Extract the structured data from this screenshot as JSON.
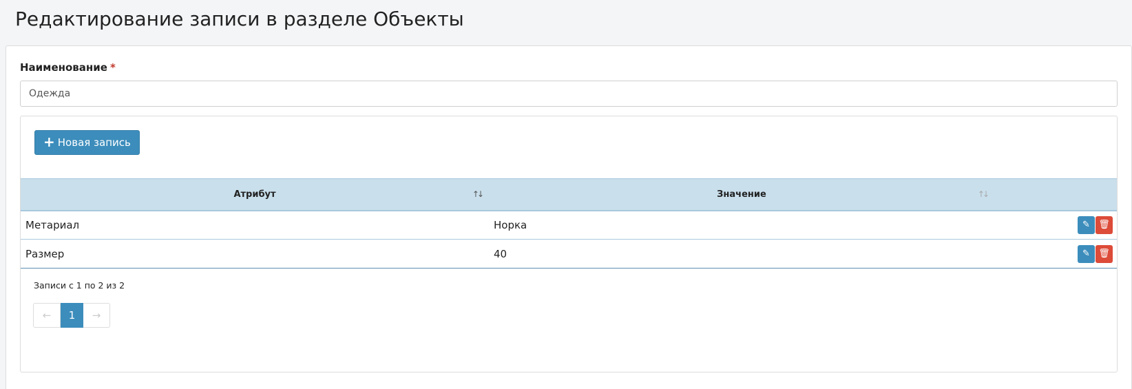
{
  "page": {
    "title": "Редактирование записи в разделе Объекты"
  },
  "form": {
    "name_label": "Наименование",
    "required_mark": "*",
    "name_value": "Одежда"
  },
  "toolbar": {
    "new_record_icon": "plus-icon",
    "new_record_label": "Новая запись"
  },
  "table": {
    "columns": [
      {
        "label": "Атрибут",
        "sort_icon": "sort-asc-icon"
      },
      {
        "label": "Значение",
        "sort_icon": "sort-icon"
      }
    ],
    "rows": [
      {
        "attribute": "Метариал",
        "value": "Норка"
      },
      {
        "attribute": "Размер",
        "value": "40"
      }
    ],
    "row_actions": [
      "pencil-icon",
      "trash-icon"
    ]
  },
  "footer": {
    "records_info": "Записи с 1 по 2 из 2",
    "pagination": {
      "prev": "←",
      "current": "1",
      "next": "→"
    }
  },
  "colors": {
    "primary": "#3c8dbc",
    "danger": "#dd4b39",
    "header_bg": "#c9dfec"
  }
}
